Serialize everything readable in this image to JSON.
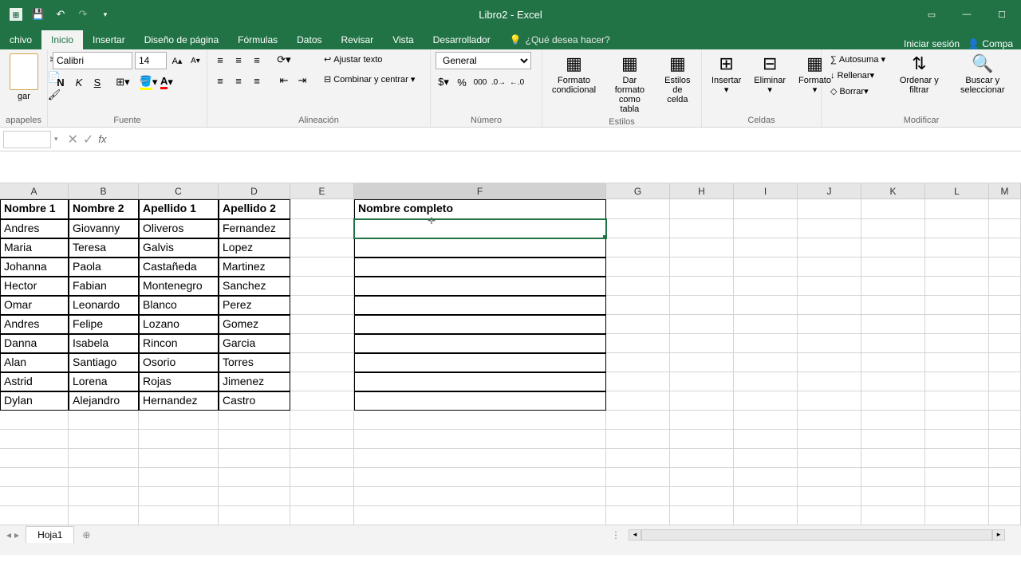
{
  "titlebar": {
    "title": "Libro2 - Excel"
  },
  "tabs": {
    "items": [
      "chivo",
      "Inicio",
      "Insertar",
      "Diseño de página",
      "Fórmulas",
      "Datos",
      "Revisar",
      "Vista",
      "Desarrollador"
    ],
    "active_index": 1,
    "tell_me": "¿Qué desea hacer?",
    "signin": "Iniciar sesión",
    "share": "Compa"
  },
  "ribbon": {
    "clipboard": {
      "paste": "gar",
      "label": "apapeles"
    },
    "font": {
      "name": "Calibri",
      "size": "14",
      "bold": "N",
      "italic": "K",
      "underline": "S",
      "label": "Fuente"
    },
    "alignment": {
      "wrap": "Ajustar texto",
      "merge": "Combinar y centrar",
      "label": "Alineación"
    },
    "number": {
      "format": "General",
      "label": "Número"
    },
    "styles": {
      "cond": "Formato condicional",
      "table": "Dar formato como tabla",
      "cell": "Estilos de celda",
      "label": "Estilos"
    },
    "cells": {
      "insert": "Insertar",
      "delete": "Eliminar",
      "format": "Formato",
      "label": "Celdas"
    },
    "editing": {
      "sum": "Autosuma",
      "fill": "Rellenar",
      "clear": "Borrar",
      "sort": "Ordenar y filtrar",
      "find": "Buscar y seleccionar",
      "label": "Modificar"
    }
  },
  "fbar": {
    "fx": "fx"
  },
  "columns": [
    "A",
    "B",
    "C",
    "D",
    "E",
    "F",
    "G",
    "H",
    "I",
    "J",
    "K",
    "L",
    "M"
  ],
  "headers": {
    "A": "Nombre 1",
    "B": "Nombre 2",
    "C": "Apellido 1",
    "D": "Apellido 2",
    "F": "Nombre completo"
  },
  "data": [
    {
      "A": "Andres",
      "B": "Giovanny",
      "C": "Oliveros",
      "D": "Fernandez"
    },
    {
      "A": "Maria",
      "B": "Teresa",
      "C": "Galvis",
      "D": "Lopez"
    },
    {
      "A": "Johanna",
      "B": "Paola",
      "C": "Castañeda",
      "D": "Martinez"
    },
    {
      "A": "Hector",
      "B": "Fabian",
      "C": "Montenegro",
      "D": "Sanchez"
    },
    {
      "A": "Omar",
      "B": "Leonardo",
      "C": "Blanco",
      "D": "Perez"
    },
    {
      "A": "Andres",
      "B": "Felipe",
      "C": "Lozano",
      "D": "Gomez"
    },
    {
      "A": "Danna",
      "B": "Isabela",
      "C": "Rincon",
      "D": "Garcia"
    },
    {
      "A": "Alan",
      "B": "Santiago",
      "C": "Osorio",
      "D": "Torres"
    },
    {
      "A": "Astrid",
      "B": "Lorena",
      "C": "Rojas",
      "D": "Jimenez"
    },
    {
      "A": "Dylan",
      "B": "Alejandro",
      "C": "Hernandez",
      "D": "Castro"
    }
  ],
  "sheet": {
    "name": "Hoja1"
  }
}
